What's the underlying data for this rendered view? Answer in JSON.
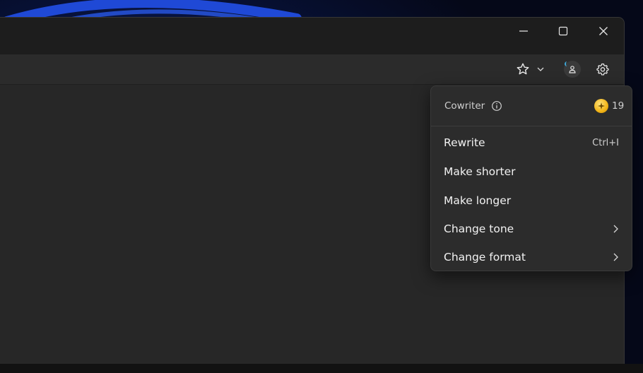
{
  "menu": {
    "title": "Cowriter",
    "credits": "19",
    "items": [
      {
        "label": "Rewrite",
        "shortcut": "Ctrl+I",
        "submenu": false
      },
      {
        "label": "Make shorter",
        "shortcut": "",
        "submenu": false
      },
      {
        "label": "Make longer",
        "shortcut": "",
        "submenu": false
      },
      {
        "label": "Change tone",
        "shortcut": "",
        "submenu": true
      },
      {
        "label": "Change format",
        "shortcut": "",
        "submenu": true
      }
    ]
  },
  "icons": {
    "minimize": "minimize-icon",
    "maximize": "maximize-icon",
    "close": "close-icon",
    "favorite": "star-icon",
    "favorite_dropdown": "chevron-down-icon",
    "profile": "profile-icon",
    "settings": "gear-icon",
    "info": "info-icon",
    "credits": "sparkle-coin-icon",
    "submenu": "chevron-right-icon"
  },
  "colors": {
    "window_bg": "#272727",
    "titlebar_bg": "#1d1d1d",
    "menu_bg": "#2c2c2c",
    "coin": "#f2b417",
    "profile_accent": "#3fa9d9"
  }
}
